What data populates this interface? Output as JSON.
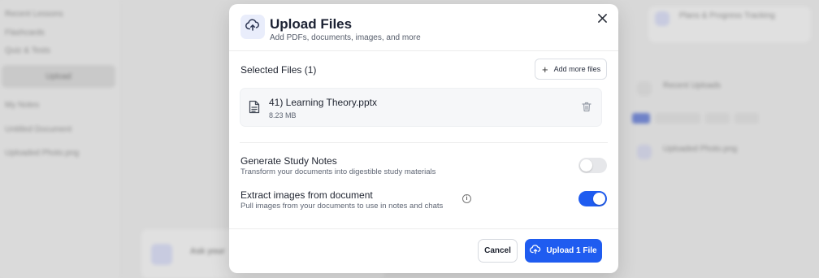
{
  "background": {
    "sidebar_items": [
      "Recent Lessons",
      "Flashcards",
      "Quiz & Tests"
    ],
    "upload_label": "Upload",
    "notes_label": "My Notes",
    "docs": [
      "Untitled Document",
      "Uploaded Photo.png"
    ],
    "right_cards": [
      "Plans & Progress Tracking",
      "Recent Uploads",
      "Uploaded Photo.png"
    ],
    "bottom_card": "Ask your"
  },
  "modal": {
    "title": "Upload Files",
    "subtitle": "Add PDFs, documents, images, and more",
    "selected_files_label": "Selected Files (1)",
    "add_more_label": "Add more files",
    "file": {
      "name": "41) Learning Theory.pptx",
      "size": "8.23 MB"
    },
    "options": [
      {
        "title": "Generate Study Notes",
        "description": "Transform your documents into digestible study materials",
        "enabled": false
      },
      {
        "title": "Extract images from document",
        "description": "Pull images from your documents to use in notes and chats",
        "enabled": true
      }
    ],
    "cancel_label": "Cancel",
    "upload_label": "Upload 1 File"
  },
  "colors": {
    "accent": "#1f5cf0",
    "icon_bg": "#e9edfb"
  },
  "icons": {
    "header": "cloud-upload-icon",
    "close": "close-icon",
    "add": "plus-icon",
    "file": "document-icon",
    "delete": "trash-icon",
    "info": "info-icon",
    "upload": "cloud-upload-icon"
  }
}
